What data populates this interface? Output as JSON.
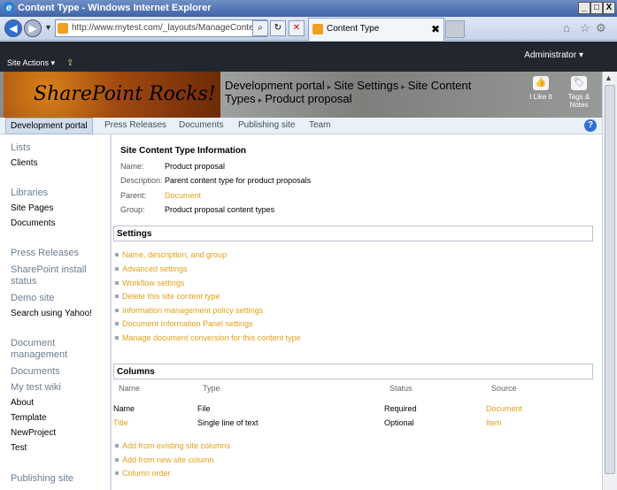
{
  "window": {
    "title": "Content Type - Windows Internet Explorer",
    "buttons": [
      "_",
      "□",
      "X"
    ]
  },
  "browser": {
    "address": "http://www.mytest.com/_layouts/ManageContentT",
    "tab_title": "Content Type",
    "tab_close": "✖",
    "icons": [
      "home-icon",
      "favorites-icon",
      "tools-icon"
    ]
  },
  "ribbon": {
    "site_actions": "Site Actions ▾",
    "user": "Administrator ▾"
  },
  "banner": {
    "logo_text": "SharePoint Rocks!",
    "breadcrumb": [
      "Development portal",
      "Site Settings",
      "Site Content Types",
      "Product proposal"
    ],
    "like_label": "I Like It",
    "tags_label": "Tags & Notes"
  },
  "topnav": {
    "items": [
      "Development portal",
      "Press Releases",
      "Documents",
      "Publishing site",
      "Team"
    ],
    "help": "?"
  },
  "quicklaunch": {
    "items": [
      {
        "label": "Lists",
        "heading": true
      },
      {
        "label": "Clients",
        "heading": false
      },
      {
        "label": "Libraries",
        "heading": true
      },
      {
        "label": "Site Pages",
        "heading": false
      },
      {
        "label": "Documents",
        "heading": false
      },
      {
        "label": "Press Releases",
        "heading": true
      },
      {
        "label": "SharePoint install status",
        "heading": true
      },
      {
        "label": "Demo site",
        "heading": true
      },
      {
        "label": "Search using Yahoo!",
        "heading": false
      },
      {
        "label": "Document management",
        "heading": true
      },
      {
        "label": "Documents",
        "heading": true
      },
      {
        "label": "My test wiki",
        "heading": true
      },
      {
        "label": "About",
        "heading": false
      },
      {
        "label": "Template",
        "heading": false
      },
      {
        "label": "NewProject",
        "heading": false
      },
      {
        "label": "Test",
        "heading": false
      },
      {
        "label": "Publishing site",
        "heading": true
      }
    ]
  },
  "info": {
    "title": "Site Content Type Information",
    "rows": [
      {
        "label": "Name:",
        "value": "Product proposal"
      },
      {
        "label": "Description:",
        "value": "Parent content type for product proposals"
      },
      {
        "label": "Parent:",
        "value": "Document"
      },
      {
        "label": "Group:",
        "value": "Product proposal content types"
      }
    ]
  },
  "settings": {
    "heading": "Settings",
    "links": [
      "Name, description, and group",
      "Advanced settings",
      "Workflow settings",
      "Delete this site content type",
      "Information management policy settings",
      "Document Information Panel settings",
      "Manage document conversion for this content type"
    ]
  },
  "columns": {
    "heading": "Columns",
    "headers": [
      "Name",
      "Type",
      "Status",
      "Source"
    ],
    "rows": [
      {
        "name": "Name",
        "type": "File",
        "status": "Required",
        "source": "Document"
      },
      {
        "name": "Title",
        "type": "Single line of text",
        "status": "Optional",
        "source": "Item"
      }
    ],
    "links": [
      "Add from existing site columns",
      "Add from new site column",
      "Column order"
    ]
  },
  "colors": {
    "link": "#e4a01a",
    "ribbon": "#21262f"
  }
}
